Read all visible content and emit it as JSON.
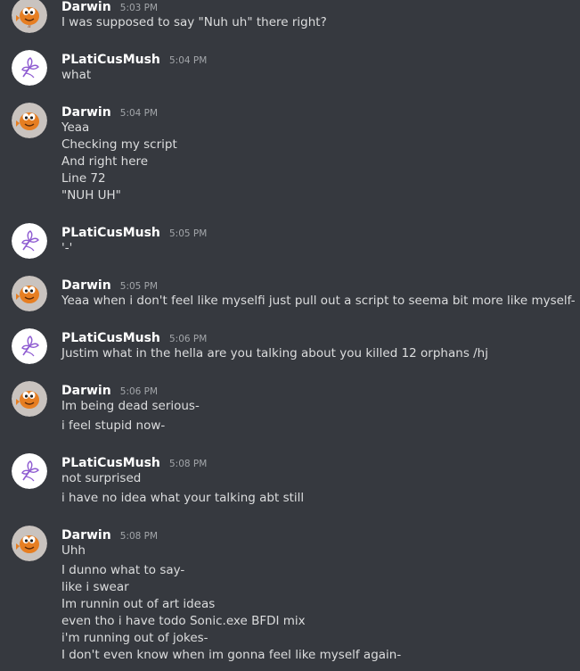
{
  "users": {
    "darwin": {
      "name": "Darwin"
    },
    "platicus": {
      "name": "PLatiCusMush"
    }
  },
  "messages": [
    {
      "time": "5:03 PM",
      "lines": [
        "I was supposed to say \"Nuh uh\" there right?"
      ]
    },
    {
      "time": "5:04 PM",
      "lines": [
        "what"
      ]
    },
    {
      "time": "5:04 PM",
      "lines": [
        "Yeaa",
        "Checking my script",
        "And right here",
        "Line 72",
        "\"NUH UH\""
      ]
    },
    {
      "time": "5:05 PM",
      "lines": [
        "'-'"
      ]
    },
    {
      "time": "5:05 PM",
      "lines": [
        "Yeaa when i don't feel like myselfi just pull out a script to seema bit more like myself-"
      ]
    },
    {
      "time": "5:06 PM",
      "lines": [
        "Justim what in the hella are you talking about you killed 12 orphans /hj"
      ]
    },
    {
      "time": "5:06 PM",
      "lines": [
        "Im being dead serious-",
        "i feel stupid now-"
      ]
    },
    {
      "time": "5:08 PM",
      "lines": [
        "not surprised",
        "i have no idea what your talking abt still"
      ]
    },
    {
      "time": "5:08 PM",
      "lines": [
        "Uhh",
        "I dunno what to say-",
        "like i swear",
        "Im runnin out of art ideas",
        "even tho i have todo Sonic.exe BFDI mix",
        "i'm running out of jokes-",
        "I don't even know when im gonna feel like myself again-"
      ]
    }
  ],
  "icons": {
    "darwin_avatar": "orange-fish-avatar-icon",
    "platicus_avatar": "purple-flower-sketch-avatar-icon"
  },
  "colors": {
    "background": "#36393f",
    "username": "#ffffff",
    "timestamp": "#a3a6aa",
    "message_text": "#dcddde"
  }
}
